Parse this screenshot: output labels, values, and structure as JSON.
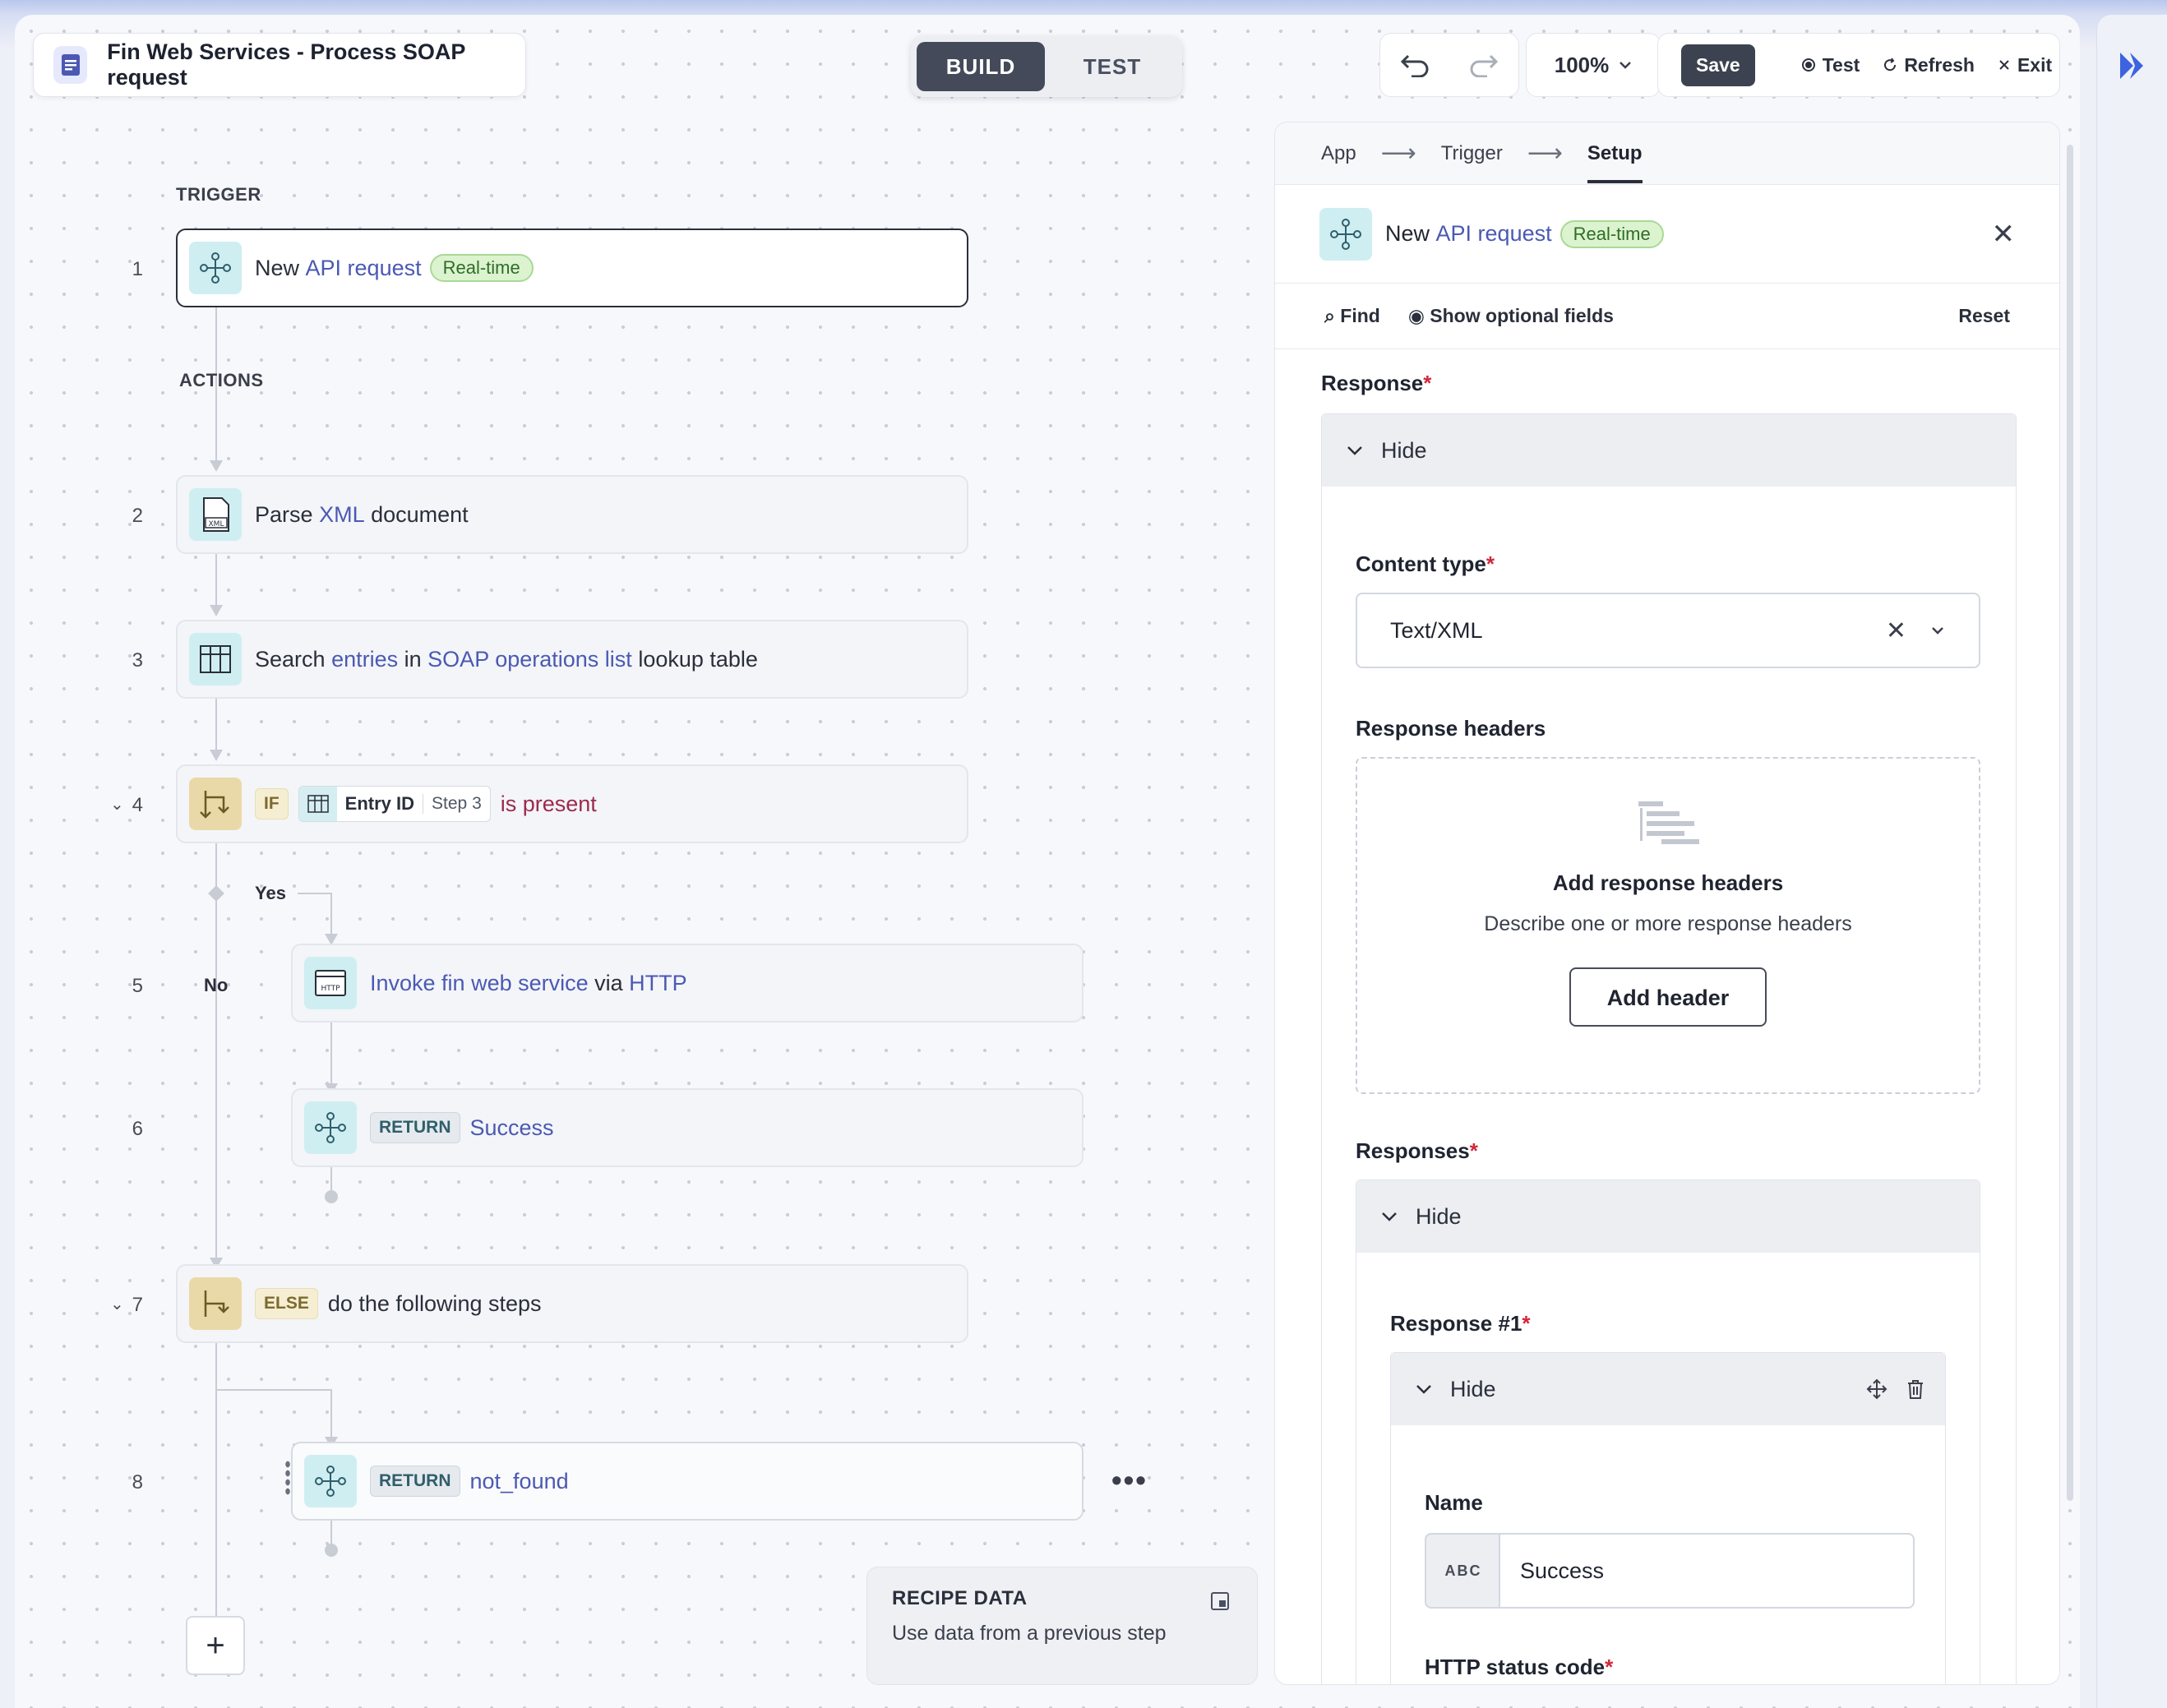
{
  "recipe": {
    "title": "Fin Web Services - Process SOAP request"
  },
  "modes": [
    {
      "label": "BUILD",
      "active": true
    },
    {
      "label": "TEST",
      "active": false
    }
  ],
  "toolbar": {
    "zoom": "100%",
    "save": "Save",
    "test": "Test",
    "refresh": "Refresh",
    "exit": "Exit"
  },
  "flow": {
    "trigger_label": "TRIGGER",
    "actions_label": "ACTIONS",
    "steps": {
      "s1": {
        "num": "1",
        "pre": "New",
        "link": "API request",
        "badge": "Real-time"
      },
      "s2": {
        "num": "2",
        "pre": "Parse",
        "link": "XML",
        "post": "document"
      },
      "s3": {
        "num": "3",
        "pre": "Search",
        "link1": "entries",
        "mid": "in",
        "link2": "SOAP operations list",
        "post": "lookup table"
      },
      "s4": {
        "num": "4",
        "kw": "IF",
        "pill_field": "Entry ID",
        "pill_step": "Step 3",
        "cond": "is present"
      },
      "s5": {
        "num": "5",
        "link1": "Invoke fin web service",
        "mid": "via",
        "link2": "HTTP"
      },
      "s6": {
        "num": "6",
        "kw": "RETURN",
        "link": "Success"
      },
      "s7": {
        "num": "7",
        "kw": "ELSE",
        "text": "do the following steps"
      },
      "s8": {
        "num": "8",
        "kw": "RETURN",
        "link": "not_found"
      }
    },
    "branch_yes": "Yes",
    "branch_no": "No"
  },
  "recipe_data": {
    "title": "RECIPE DATA",
    "subtitle": "Use data from a previous step"
  },
  "panel": {
    "crumbs": [
      "App",
      "Trigger",
      "Setup"
    ],
    "header": {
      "pre": "New",
      "link": "API request",
      "badge": "Real-time"
    },
    "find": "Find",
    "show_optional": "Show optional fields",
    "reset": "Reset",
    "response_label": "Response",
    "hide": "Hide",
    "content_type_label": "Content type",
    "content_type_value": "Text/XML",
    "response_headers_label": "Response headers",
    "add_headers_title": "Add response headers",
    "add_headers_sub": "Describe one or more response headers",
    "add_header_btn": "Add header",
    "responses_label": "Responses",
    "response1_label": "Response #1",
    "name_label": "Name",
    "name_type": "ABC",
    "name_value": "Success",
    "status_code_label": "HTTP status code"
  },
  "colors": {
    "link": "#4b59b3",
    "accent_dark": "#444a59",
    "teal_icon": "#cfeef2",
    "gold_icon": "#ead9a8",
    "badge_green": "#dcf3cf",
    "required": "#d0273a"
  }
}
